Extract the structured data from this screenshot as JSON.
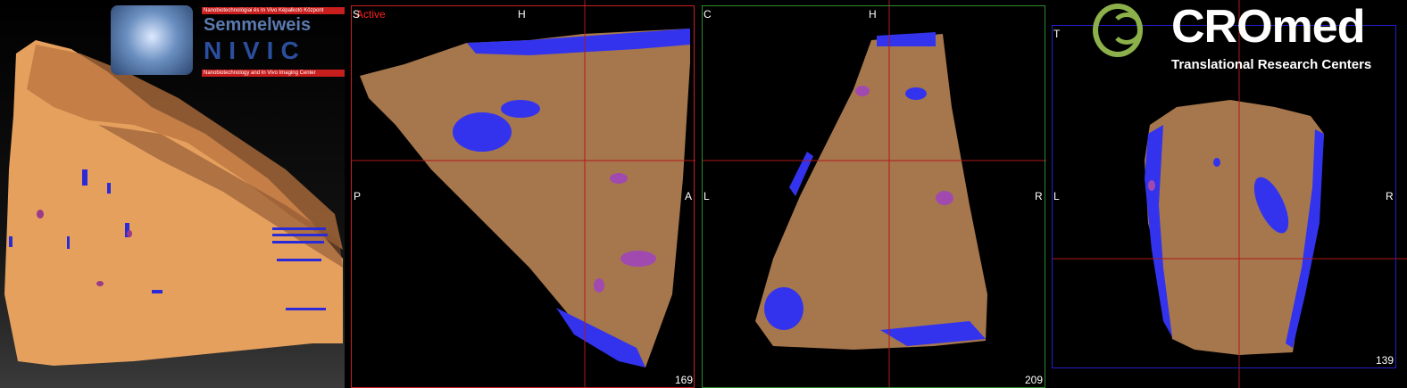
{
  "logos": {
    "semmelweis": {
      "title": "Semmelweis",
      "subtitle": "NIVIC",
      "tagline_top": "Nanobiotechnológiai és In Vivo Képalkotó Központ",
      "tagline_bottom": "Nanobiotechnology and In Vivo Imaging Center"
    },
    "cromed": {
      "title": "CROmed",
      "subtitle": "Translational Research Centers"
    }
  },
  "views": {
    "sagittal": {
      "status": "Active",
      "top": "H",
      "left": "P",
      "right": "A",
      "corner": "S",
      "slice": "169",
      "border_color": "#c82020"
    },
    "coronal": {
      "top": "H",
      "left": "L",
      "right": "R",
      "corner": "C",
      "slice": "209",
      "border_color": "#2e8b2e"
    },
    "axial": {
      "left": "L",
      "right": "R",
      "corner": "T",
      "slice": "139",
      "border_color": "#2020c8"
    }
  },
  "colors": {
    "tissue": "#a6774d",
    "surface": "#e8a15c",
    "blue_region": "#3333ee",
    "purple_region": "#a04ab0",
    "crosshair": "#b01a1a"
  }
}
